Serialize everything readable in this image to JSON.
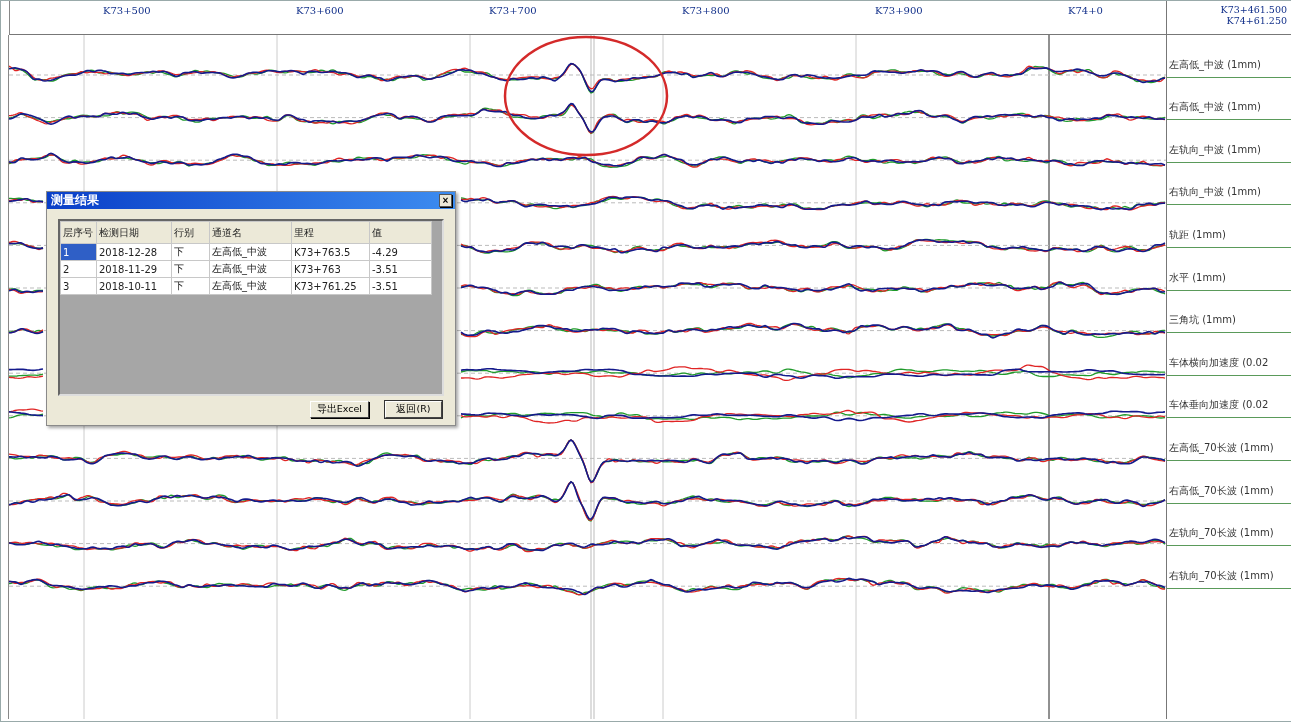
{
  "ruler": {
    "marks": [
      "K73+500",
      "K73+600",
      "K73+700",
      "K73+800",
      "K73+900",
      "K74+0"
    ],
    "range": [
      "K73+461.500",
      "K74+61.250"
    ]
  },
  "channels": [
    {
      "name": "左高低_中波 (1mm)"
    },
    {
      "name": "右高低_中波 (1mm)"
    },
    {
      "name": "左轨向_中波 (1mm)"
    },
    {
      "name": "右轨向_中波 (1mm)"
    },
    {
      "name": "轨距 (1mm)"
    },
    {
      "name": "水平 (1mm)"
    },
    {
      "name": "三角坑 (1mm)"
    },
    {
      "name": "车体横向加速度 (0.02"
    },
    {
      "name": "车体垂向加速度 (0.02"
    },
    {
      "name": "左高低_70长波 (1mm)"
    },
    {
      "name": "右高低_70长波 (1mm)"
    },
    {
      "name": "左轨向_70长波 (1mm)"
    },
    {
      "name": "右轨向_70长波 (1mm)"
    }
  ],
  "dialog": {
    "title": "测量结果",
    "close": "×",
    "columns": [
      "层序号",
      "检测日期",
      "行别",
      "通道名",
      "里程",
      "值"
    ],
    "rows": [
      {
        "selected": true,
        "cells": [
          "1",
          "2018-12-28",
          "下",
          "左高低_中波",
          "K73+763.5",
          "-4.29"
        ]
      },
      {
        "selected": false,
        "cells": [
          "2",
          "2018-11-29",
          "下",
          "左高低_中波",
          "K73+763",
          "-3.51"
        ]
      },
      {
        "selected": false,
        "cells": [
          "3",
          "2018-10-11",
          "下",
          "左高低_中波",
          "K73+761.25",
          "-3.51"
        ]
      }
    ],
    "buttons": [
      "导出Excel",
      "返回(R)"
    ]
  }
}
